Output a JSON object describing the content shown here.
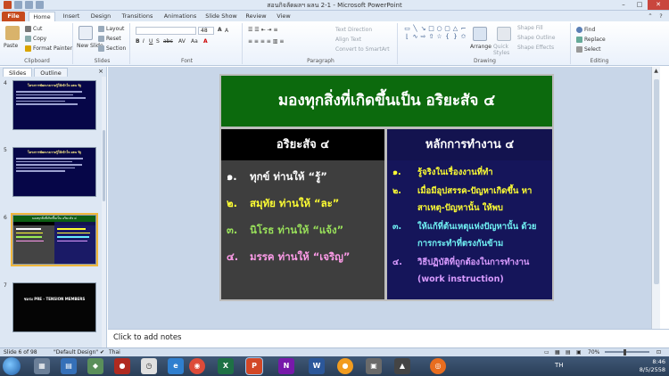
{
  "window": {
    "title": "สอนกิจลัดผลฯ ผลน 2-1 - Microsoft PowerPoint",
    "min": "–",
    "max": "□",
    "close": "✕"
  },
  "tabs": [
    "File",
    "Home",
    "Insert",
    "Design",
    "Transitions",
    "Animations",
    "Slide Show",
    "Review",
    "View"
  ],
  "ribbon": {
    "clipboard": {
      "paste": "Paste",
      "cut": "Cut",
      "copy": "Copy",
      "format_painter": "Format Painter",
      "label": "Clipboard"
    },
    "slides": {
      "new_slide": "New Slide",
      "layout": "Layout",
      "reset": "Reset",
      "section": "Section",
      "label": "Slides"
    },
    "font": {
      "font_name": "",
      "font_size": "48",
      "label": "Font"
    },
    "paragraph": {
      "text_direction": "Text Direction",
      "align_text": "Align Text",
      "convert": "Convert to SmartArt",
      "label": "Paragraph"
    },
    "drawing": {
      "arrange": "Arrange",
      "quick_styles": "Quick Styles",
      "shape_fill": "Shape Fill",
      "shape_outline": "Shape Outline",
      "shape_effects": "Shape Effects",
      "label": "Drawing"
    },
    "editing": {
      "find": "Find",
      "replace": "Replace",
      "select": "Select",
      "label": "Editing"
    }
  },
  "pane": {
    "tabs": [
      "Slides",
      "Outline"
    ],
    "close": "×",
    "thumbnails": [
      {
        "num": "4",
        "title": "โครงการพัฒนาความรู้ให้เข้าใจ ผลน รัฐ"
      },
      {
        "num": "5",
        "title": "โครงการพัฒนาความรู้ให้เข้าใจ ผลน รัฐ"
      },
      {
        "num": "6",
        "title": "มองทุกสิ่งที่เกิดขึ้นเป็น อริยะสัจ ๔"
      },
      {
        "num": "7",
        "title": "ชมรม PRE - TENSION MEMBERS"
      }
    ]
  },
  "slide": {
    "title": "มองทุกสิ่งที่เกิดขึ้นเป็น อริยะสัจ ๔",
    "left_header": "อริยะสัจ ๔",
    "right_header": "หลักการทำงาน ๔",
    "left_items": [
      {
        "num": "๑.",
        "text": "ทุกข์ ท่านให้ “รู้”"
      },
      {
        "num": "๒.",
        "text": "สมุทัย ท่านให้ “ละ”"
      },
      {
        "num": "๓.",
        "text": "นิโรธ ท่านให้ “แจ้ง”"
      },
      {
        "num": "๔.",
        "text": "มรรค ท่านให้ “เจริญ”"
      }
    ],
    "right_items": [
      {
        "num": "๑.",
        "text": "รู้จริงในเรื่องงานที่ทำ"
      },
      {
        "num": "๒.",
        "text": "เมื่อมีอุปสรรค-ปัญหาเกิดขึ้น หาสาเหตุ-ปัญหานั้น ให้พบ"
      },
      {
        "num": "๓.",
        "text": "ให้แก้ที่ต้นเหตุแห่งปัญหานั้น ด้วยการกระทำที่ตรงกันข้าม"
      },
      {
        "num": "๔.",
        "text": "วิธีปฏิบัติที่ถูกต้องในการทำงาน (work instruction)"
      }
    ]
  },
  "notes": {
    "placeholder": "Click to add notes"
  },
  "status": {
    "slide": "Slide 6 of 98",
    "theme": "\"Default Design\"",
    "language": "Thai",
    "zoom": "70%"
  },
  "taskbar": {
    "lang": "TH",
    "time": "8:46",
    "date": "8/5/2558"
  },
  "colors": {
    "title_bg": "#0c6a0d",
    "left_bg": "#3e3e3e",
    "right_bg": "#15155a",
    "file_tab": "#c64a1d"
  }
}
